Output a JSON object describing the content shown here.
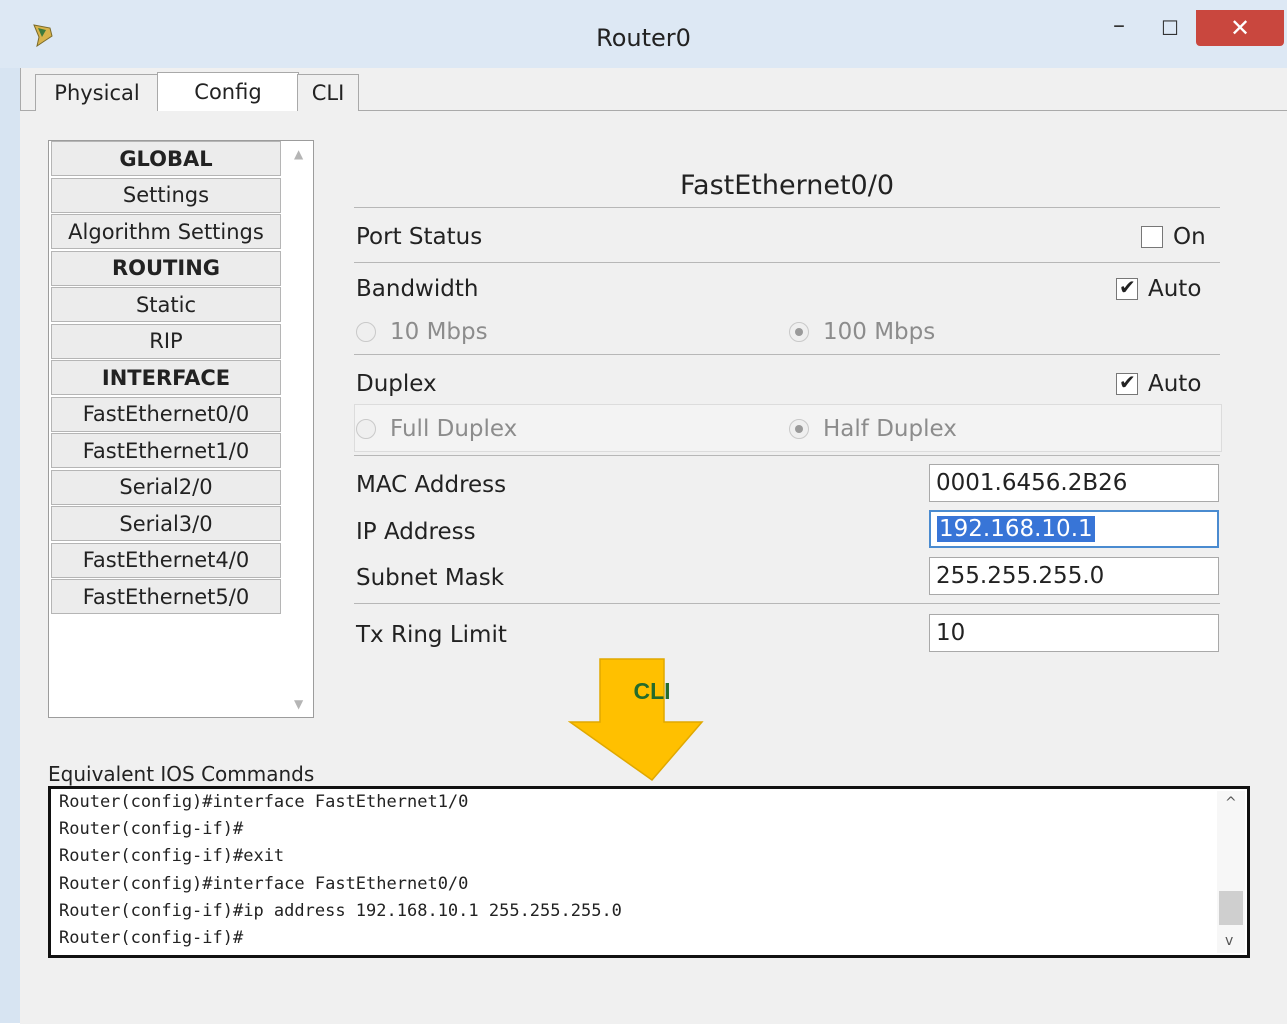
{
  "window": {
    "title": "Router0",
    "close_symbol": "✕",
    "minimize_symbol": "–",
    "maximize_symbol": "☐"
  },
  "tabs": [
    {
      "label": "Physical"
    },
    {
      "label": "Config",
      "active": true
    },
    {
      "label": "CLI"
    }
  ],
  "sidebar": {
    "items": [
      {
        "label": "GLOBAL",
        "header": true
      },
      {
        "label": "Settings"
      },
      {
        "label": "Algorithm Settings"
      },
      {
        "label": "ROUTING",
        "header": true
      },
      {
        "label": "Static"
      },
      {
        "label": "RIP"
      },
      {
        "label": "INTERFACE",
        "header": true
      },
      {
        "label": "FastEthernet0/0"
      },
      {
        "label": "FastEthernet1/0"
      },
      {
        "label": "Serial2/0"
      },
      {
        "label": "Serial3/0"
      },
      {
        "label": "FastEthernet4/0"
      },
      {
        "label": "FastEthernet5/0"
      }
    ]
  },
  "interface": {
    "title": "FastEthernet0/0",
    "port_status": {
      "label": "Port Status",
      "toggle_label": "On",
      "checked": false
    },
    "bandwidth": {
      "label": "Bandwidth",
      "auto_label": "Auto",
      "auto_checked": true,
      "option_10": "10 Mbps",
      "option_100": "100 Mbps",
      "selected": "100 Mbps"
    },
    "duplex": {
      "label": "Duplex",
      "auto_label": "Auto",
      "auto_checked": true,
      "option_full": "Full Duplex",
      "option_half": "Half Duplex",
      "selected": "Half Duplex"
    },
    "mac": {
      "label": "MAC Address",
      "value": "0001.6456.2B26"
    },
    "ip": {
      "label": "IP Address",
      "value": "192.168.10.1"
    },
    "subnet": {
      "label": "Subnet Mask",
      "value": "255.255.255.0"
    },
    "tx_ring": {
      "label": "Tx Ring Limit",
      "value": "10"
    }
  },
  "callout": {
    "text": "CLI",
    "color": "#ffc000"
  },
  "ios": {
    "label": "Equivalent IOS Commands",
    "lines": [
      "Router(config)#interface FastEthernet1/0",
      "Router(config-if)#",
      "Router(config-if)#exit",
      "Router(config)#interface FastEthernet0/0",
      "Router(config-if)#ip address 192.168.10.1 255.255.255.0",
      "Router(config-if)#"
    ]
  }
}
